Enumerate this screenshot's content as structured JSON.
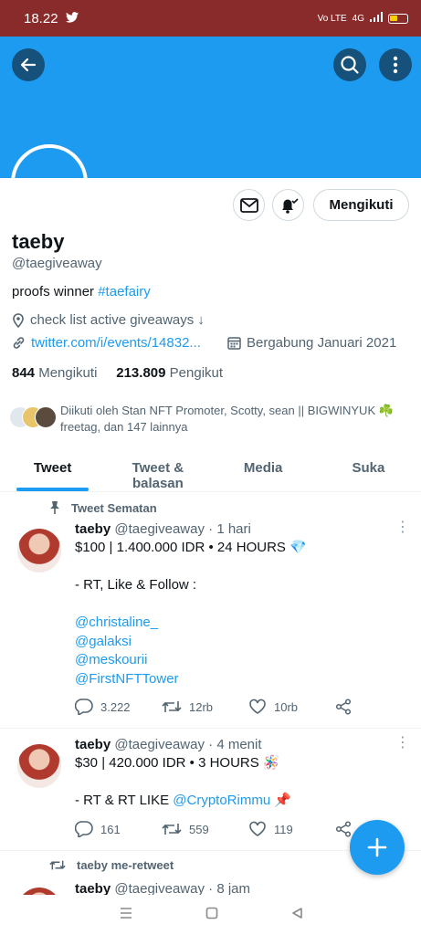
{
  "status_bar": {
    "time": "18.22",
    "network": "Vo LTE",
    "signal": "4G"
  },
  "profile": {
    "follow_button": "Mengikuti",
    "name": "taeby",
    "handle": "@taegiveaway",
    "bio_text": "proofs winner ",
    "bio_hashtag": "#taefairy",
    "location": "check list active giveaways ↓",
    "website": "twitter.com/i/events/14832...",
    "joined": "Bergabung Januari 2021",
    "following_count": "844",
    "following_label": "Mengikuti",
    "followers_count": "213.809",
    "followers_label": "Pengikut",
    "followed_by": "Diikuti oleh Stan NFT Promoter, Scotty, sean || BIGWINYUK ☘️ freetag, dan 147 lainnya"
  },
  "tabs": [
    {
      "label": "Tweet",
      "active": true
    },
    {
      "label": "Tweet & balasan",
      "active": false
    },
    {
      "label": "Media",
      "active": false
    },
    {
      "label": "Suka",
      "active": false
    }
  ],
  "pinned_label": "Tweet Sematan",
  "tweets": [
    {
      "name": "taeby",
      "handle": "@taegiveaway",
      "time": "· 1 hari",
      "lines": [
        "$100 | 1.400.000 IDR • 24 HOURS 💎",
        "",
        "- RT, Like & Follow :",
        ""
      ],
      "mentions": [
        "@christaline_",
        "@galaksi",
        "@meskourii",
        "@FirstNFTTower"
      ],
      "replies": "3.222",
      "retweets": "12rb",
      "likes": "10rb"
    },
    {
      "name": "taeby",
      "handle": "@taegiveaway",
      "time": "· 4 menit",
      "line1": "$30 | 420.000 IDR • 3 HOURS 🪅",
      "line2_prefix": "- RT & RT LIKE ",
      "line2_mention": "@CryptoRimmu",
      "line2_suffix": " 📌",
      "replies": "161",
      "retweets": "559",
      "likes": "119"
    }
  ],
  "retweet_row": {
    "label": "taeby me-retweet"
  },
  "tweet3": {
    "name": "taeby",
    "handle": "@taegiveaway",
    "time": "· 8 jam"
  },
  "colors": {
    "accent": "#1d9bf0",
    "status_bar": "#8a2b2b"
  },
  "icons": [
    "back-arrow-icon",
    "search-icon",
    "more-vertical-icon",
    "mail-icon",
    "bell-icon",
    "location-icon",
    "link-icon",
    "calendar-icon",
    "pin-icon",
    "reply-icon",
    "retweet-icon",
    "like-icon",
    "share-icon",
    "plus-icon"
  ]
}
